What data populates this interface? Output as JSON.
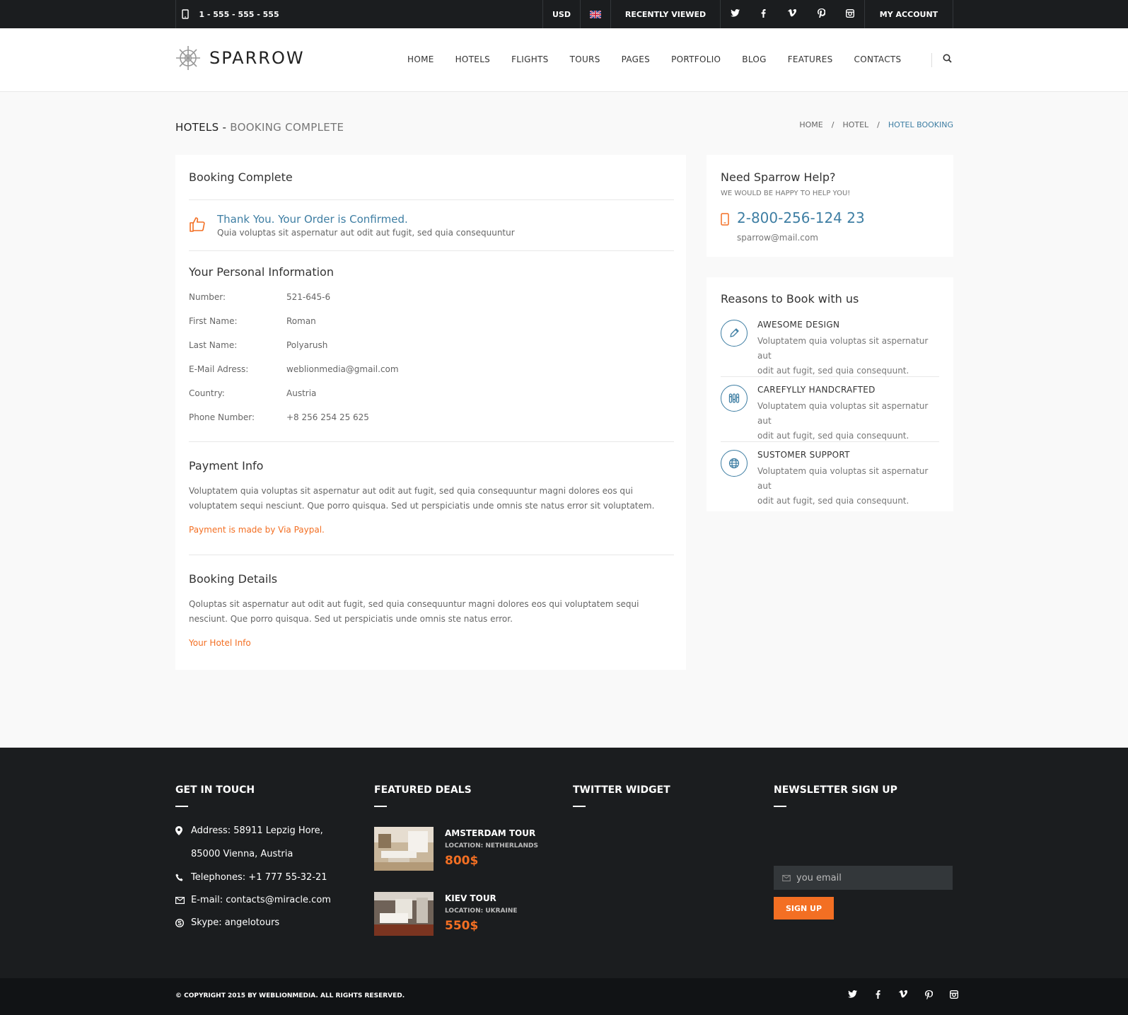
{
  "topbar": {
    "phone": "1 - 555 - 555 - 555",
    "currency": "USD",
    "recently_viewed": "RECENTLY VIEWED",
    "my_account": "MY ACCOUNT",
    "social": [
      "twitter-icon",
      "facebook-icon",
      "vimeo-icon",
      "pinterest-icon",
      "instagram-icon"
    ]
  },
  "header": {
    "logo": "SPARROW",
    "nav": [
      "HOME",
      "HOTELS",
      "FLIGHTS",
      "TOURS",
      "PAGES",
      "PORTFOLIO",
      "BLOG",
      "FEATURES",
      "CONTACTS"
    ]
  },
  "page": {
    "title": "HOTELS -",
    "subtitle": "BOOKING COMPLETE",
    "breadcrumb": [
      "HOME",
      "/",
      "HOTEL",
      "/",
      "HOTEL BOOKING"
    ]
  },
  "main": {
    "heading": "Booking Complete",
    "confirm_title": "Thank You. Your Order is Confirmed.",
    "confirm_text": "Quia voluptas sit aspernatur aut odit aut fugit, sed quia consequuntur",
    "personal_heading": "Your Personal Information",
    "personal": [
      {
        "k": "Number:",
        "v": "521-645-6"
      },
      {
        "k": "First Name:",
        "v": "Roman"
      },
      {
        "k": "Last Name:",
        "v": "Polyarush"
      },
      {
        "k": "E-Mail Adress:",
        "v": "weblionmedia@gmail.com"
      },
      {
        "k": "Country:",
        "v": "Austria"
      },
      {
        "k": "Phone Number:",
        "v": "+8 256 254 25 625"
      }
    ],
    "payment_heading": "Payment Info",
    "payment_text_1": "Voluptatem quia voluptas sit aspernatur aut odit aut fugit, sed quia consequuntur magni dolores eos qui",
    "payment_text_2": "voluptatem sequi nesciunt. Que porro quisqua. Sed ut perspiciatis unde omnis ste natus error sit voluptatem.",
    "payment_link": "Payment is made by Via Paypal.",
    "booking_heading": "Booking Details",
    "booking_text_1": "Qoluptas sit aspernatur aut odit aut fugit, sed quia consequuntur magni dolores eos qui voluptatem sequi",
    "booking_text_2": "nesciunt. Que porro quisqua. Sed ut perspiciatis unde omnis ste natus error.",
    "booking_link": "Your Hotel Info"
  },
  "help": {
    "title": "Need Sparrow Help?",
    "subtitle": "WE WOULD BE HAPPY TO HELP YOU!",
    "phone": "2-800-256-124 23",
    "email": "sparrow@mail.com"
  },
  "reasons": {
    "title": "Reasons to Book with us",
    "items": [
      {
        "title": "AWESOME DESIGN",
        "line1": "Voluptatem quia voluptas sit aspernatur aut",
        "line2": "odit aut fugit, sed quia consequunt.",
        "icon": "pencil-icon"
      },
      {
        "title": "CAREFYLLY HANDCRAFTED",
        "line1": "Voluptatem quia voluptas sit aspernatur aut",
        "line2": "odit aut fugit, sed quia consequunt.",
        "icon": "sliders-icon"
      },
      {
        "title": "SUSTOMER SUPPORT",
        "line1": "Voluptatem quia voluptas sit aspernatur aut",
        "line2": "odit aut fugit, sed quia consequunt.",
        "icon": "globe-icon"
      }
    ]
  },
  "footer": {
    "touch_heading": "GET IN TOUCH",
    "address_1": "Address: 58911 Lepzig Hore,",
    "address_2": "85000 Vienna, Austria",
    "telephone": "Telephones: +1 777 55-32-21",
    "email": "E-mail: contacts@miracle.com",
    "skype": "Skype: angelotours",
    "deals_heading": "FEATURED DEALS",
    "deals": [
      {
        "title": "AMSTERDAM TOUR",
        "location": "LOCATION: NETHERLANDS",
        "price": "800$"
      },
      {
        "title": "KIEV TOUR",
        "location": "LOCATION: UKRAINE",
        "price": "550$"
      }
    ],
    "twitter_heading": "TWITTER WIDGET",
    "newsletter_heading": "NEWSLETTER SIGN UP",
    "email_placeholder": "you email",
    "signup": "SIGN UP",
    "copyright": "© COPYRIGHT 2015 BY WEBLIONMEDIA. ALL RIGHTS RESERVED."
  },
  "colors": {
    "accent_blue": "#3e7ea3",
    "accent_orange": "#f36f23",
    "dark": "#1b1d1f"
  }
}
